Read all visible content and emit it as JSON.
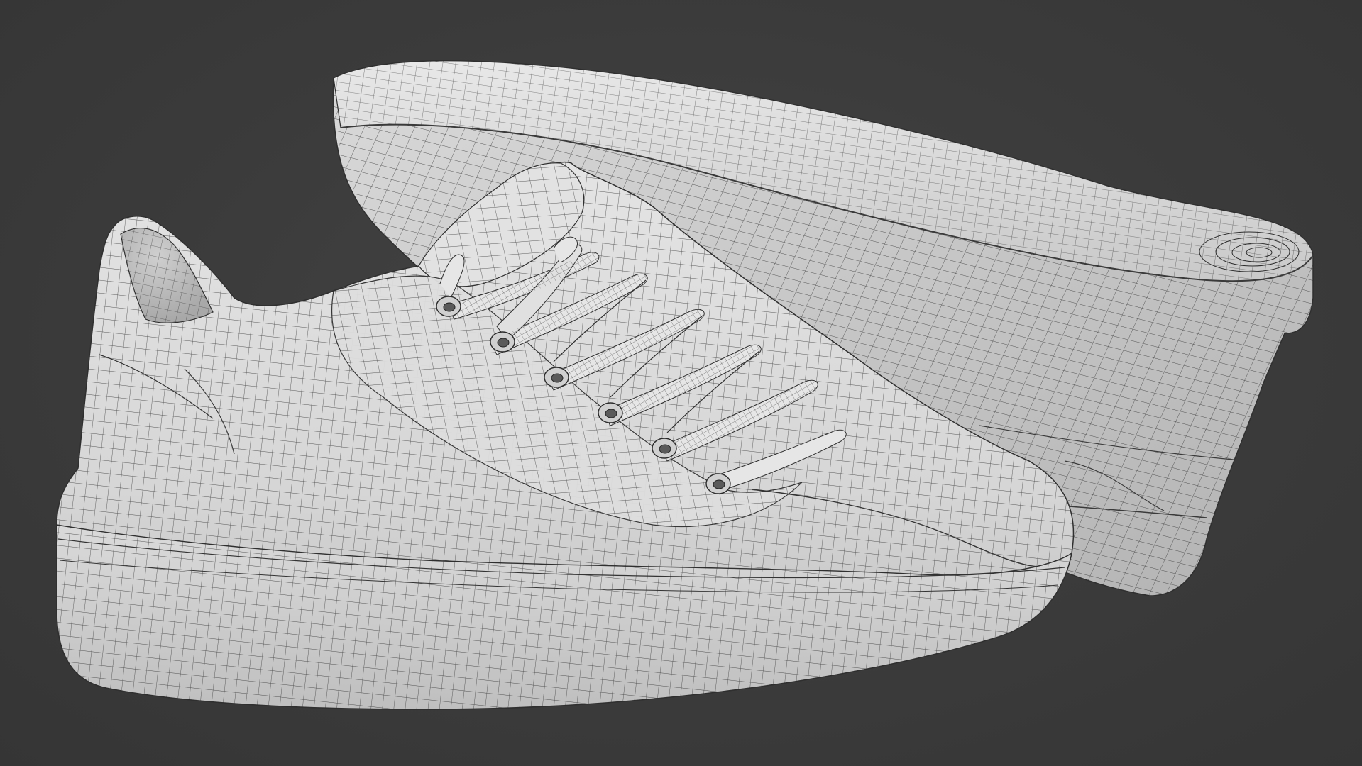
{
  "scene": {
    "description_text": "",
    "background_color": "#3a3a3a",
    "mesh_color": "#dcdcdc",
    "mesh_shadow_color": "#a9a9a9",
    "wire_color": "#2a2a2a",
    "objects": [
      {
        "name": "sneaker",
        "view": "side"
      },
      {
        "name": "sneaker",
        "view": "sole"
      }
    ],
    "eyelet_count": 6
  }
}
